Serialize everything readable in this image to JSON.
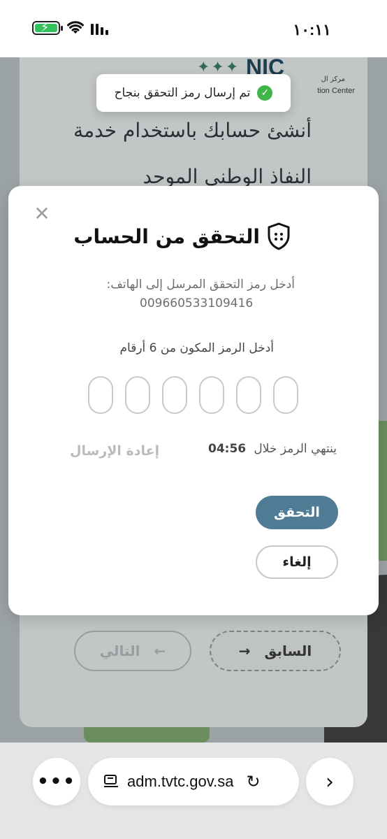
{
  "status_bar": {
    "time": "١٠:١١",
    "battery_icon": "battery-charging-icon",
    "wifi_icon": "wifi-icon",
    "signal_icon": "signal-icon"
  },
  "background_page": {
    "logo_text": "NIC",
    "logo_sub_ar": "مركز ال",
    "logo_sub_en": "tion Center",
    "heading_line1": "أنشئ حسابك باستخدام خدمة",
    "heading_line2": "النفاذ الوطني الموحد",
    "prev_label": "السابق",
    "next_label": "التالي"
  },
  "toast": {
    "message": "تم إرسال رمز التحقق بنجاح",
    "icon": "check-circle-icon"
  },
  "modal": {
    "title": "التحقق من الحساب",
    "instruction": "أدخل رمز التحقق المرسل إلى الهاتف:",
    "phone": "009660533109416",
    "code_label": "أدخل الرمز المكون من 6 أرقام",
    "otp_count": 6,
    "expire_label": "ينتهي الرمز خلال",
    "expire_time": "04:56",
    "resend_label": "إعادة الإرسال",
    "verify_label": "التحقق",
    "cancel_label": "إلغاء"
  },
  "browser": {
    "url": "adm.tvtc.gov.sa",
    "more_icon": "more-icon",
    "forward_icon": "chevron-right-icon",
    "reload_icon": "reload-icon"
  },
  "colors": {
    "primary": "#4f7b94",
    "success": "#3fb54a"
  }
}
